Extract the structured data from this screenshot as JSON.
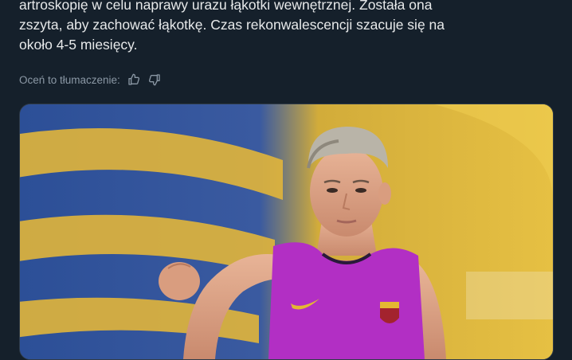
{
  "tweet": {
    "lines": [
      "artroskopię w celu naprawy urazu łąkotki wewnętrznej. Została ona",
      "zszyta, aby zachować łąkotkę. Czas rekonwalescencji szacuje się na",
      "około 4-5 miesięcy."
    ]
  },
  "translation_rating": {
    "label": "Oceń to tłumaczenie:",
    "thumbs_up_icon": "thumbs-up-icon",
    "thumbs_down_icon": "thumbs-down-icon"
  },
  "media": {
    "kind": "photo"
  },
  "colors": {
    "background": "#15202b",
    "text": "#e7e9ea",
    "secondary_text": "#8b98a5",
    "jersey": "#b22fc4",
    "stripes": "#e4b832"
  }
}
